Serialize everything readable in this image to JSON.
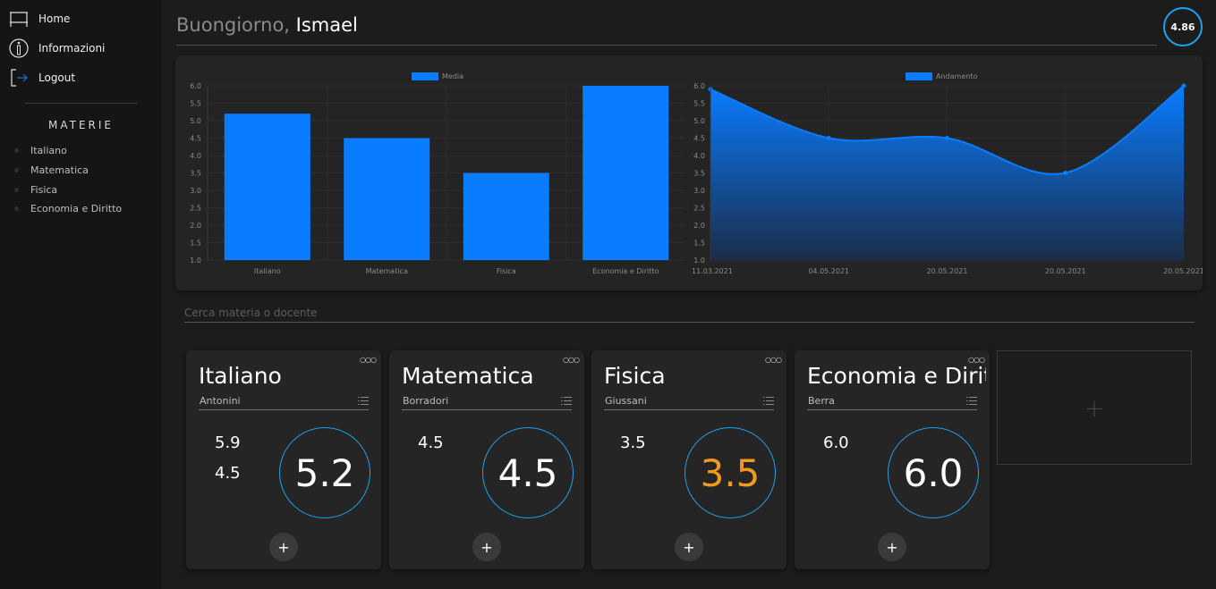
{
  "sidebar": {
    "nav": [
      {
        "label": "Home",
        "icon": "home-icon"
      },
      {
        "label": "Informazioni",
        "icon": "info-icon"
      },
      {
        "label": "Logout",
        "icon": "logout-icon"
      }
    ],
    "section_title": "MATERIE",
    "subjects": [
      "Italiano",
      "Matematica",
      "Fisica",
      "Economia e Diritto"
    ]
  },
  "header": {
    "greeting": "Buongiorno,",
    "user": "Ismael",
    "overall_average": "4.86"
  },
  "search": {
    "placeholder": "Cerca materia o docente",
    "value": ""
  },
  "colors": {
    "accent": "#1aa3f0",
    "bar": "#0a7cff",
    "warning": "#f39a1e"
  },
  "chart_data": [
    {
      "type": "bar",
      "legend": "Media",
      "categories": [
        "Italiano",
        "Matematica",
        "Fisica",
        "Economia e Diritto"
      ],
      "values": [
        5.2,
        4.5,
        3.5,
        6.0
      ],
      "ylim": [
        1.0,
        6.0
      ],
      "yticks": [
        "1.0",
        "1.5",
        "2.0",
        "2.5",
        "3.0",
        "3.5",
        "4.0",
        "4.5",
        "5.0",
        "5.5",
        "6.0"
      ],
      "legend_position": "top-center"
    },
    {
      "type": "area",
      "legend": "Andamento",
      "x": [
        "11.03.2021",
        "04.05.2021",
        "20.05.2021",
        "20.05.2021",
        "20.05.2021"
      ],
      "values": [
        5.9,
        4.5,
        4.5,
        3.5,
        6.0
      ],
      "ylim": [
        1.0,
        6.0
      ],
      "yticks": [
        "1.0",
        "1.5",
        "2.0",
        "2.5",
        "3.0",
        "3.5",
        "4.0",
        "4.5",
        "5.0",
        "5.5",
        "6.0"
      ],
      "legend_position": "top-center"
    }
  ],
  "cards": [
    {
      "name": "Italiano",
      "teacher": "Antonini",
      "grades": [
        "5.9",
        "4.5"
      ],
      "average": "5.2",
      "warning": false
    },
    {
      "name": "Matematica",
      "teacher": "Borradori",
      "grades": [
        "4.5"
      ],
      "average": "4.5",
      "warning": false
    },
    {
      "name": "Fisica",
      "teacher": "Giussani",
      "grades": [
        "3.5"
      ],
      "average": "3.5",
      "warning": true
    },
    {
      "name": "Economia e Diritto",
      "teacher": "Berra",
      "grades": [
        "6.0"
      ],
      "average": "6.0",
      "warning": false
    }
  ],
  "card_controls": {
    "more": "○○○",
    "add": "+"
  },
  "new_card": {
    "label": "+"
  }
}
